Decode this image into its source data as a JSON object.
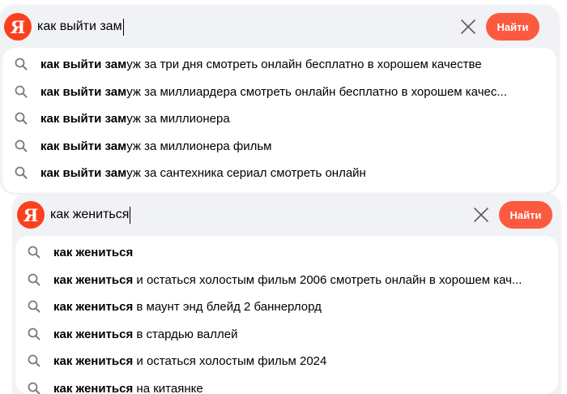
{
  "colors": {
    "brand": "#fc3f1d",
    "button": "#fc5a3f",
    "panel_bg": "#f1f2f5"
  },
  "icons": {
    "logo": "yandex-logo",
    "clear": "clear-icon",
    "suggestion": "search-icon"
  },
  "panel1": {
    "logo_letter": "Я",
    "query": "как выйти зам",
    "find_label": "Найти",
    "suggestions": [
      {
        "bold": "как выйти зам",
        "rest": "уж за три дня смотреть онлайн бесплатно в хорошем качестве"
      },
      {
        "bold": "как выйти зам",
        "rest": "уж за миллиардера смотреть онлайн бесплатно в хорошем качес..."
      },
      {
        "bold": "как выйти зам",
        "rest": "уж за миллионера"
      },
      {
        "bold": "как выйти зам",
        "rest": "уж за миллионера фильм"
      },
      {
        "bold": "как выйти зам",
        "rest": "уж за сантехника сериал смотреть онлайн"
      }
    ]
  },
  "panel2": {
    "logo_letter": "Я",
    "query": "как жениться",
    "find_label": "Найти",
    "suggestions": [
      {
        "bold": "как жениться",
        "rest": ""
      },
      {
        "bold": "как жениться",
        "rest": " и остаться холостым фильм 2006 смотреть онлайн в хорошем кач..."
      },
      {
        "bold": "как жениться",
        "rest": " в маунт энд блейд 2 баннерлорд"
      },
      {
        "bold": "как жениться",
        "rest": " в стардью валлей"
      },
      {
        "bold": "как жениться",
        "rest": " и остаться холостым фильм 2024"
      },
      {
        "bold": "как жениться",
        "rest": " на китаянке"
      }
    ]
  }
}
